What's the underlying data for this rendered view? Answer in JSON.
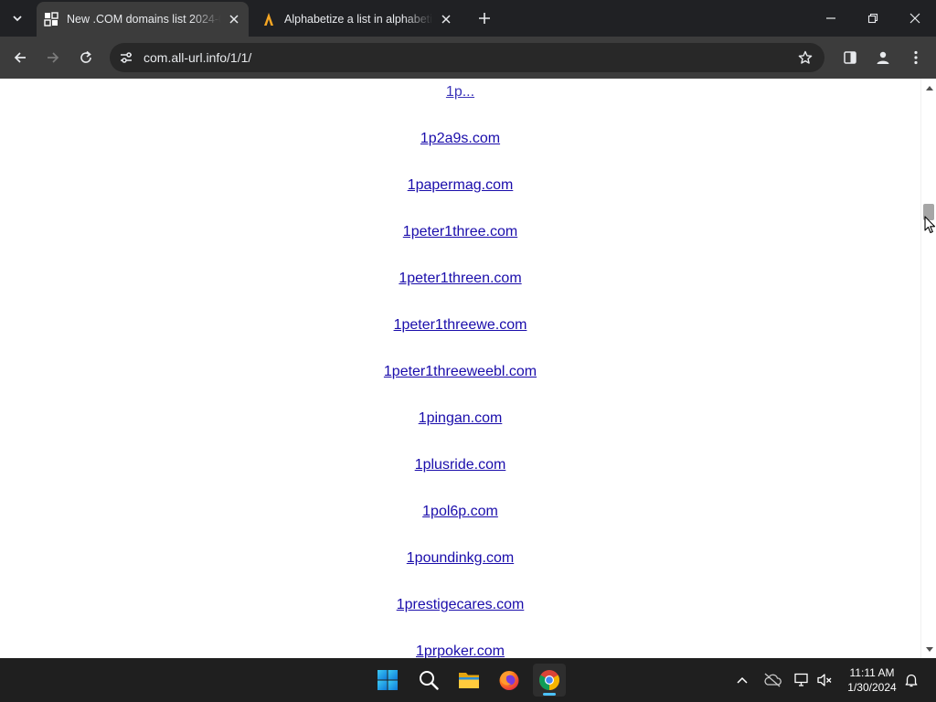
{
  "browser": {
    "tabs": [
      {
        "title": "New .COM domains list 2024-0",
        "active": true,
        "favicon": "grid-favicon-icon"
      },
      {
        "title": "Alphabetize a list in alphabetica",
        "active": false,
        "favicon": "orange-a-favicon-icon"
      }
    ],
    "url": "com.all-url.info/1/1/"
  },
  "page": {
    "partial_top_link": "1p...",
    "domains": [
      "1p2a9s.com",
      "1papermag.com",
      "1peter1three.com",
      "1peter1threen.com",
      "1peter1threewe.com",
      "1peter1threeweebl.com",
      "1pingan.com",
      "1plusride.com",
      "1pol6p.com",
      "1poundinkg.com",
      "1prestigecares.com",
      "1prpoker.com"
    ]
  },
  "taskbar": {
    "apps": [
      "windows-start-icon",
      "search-icon",
      "file-explorer-icon",
      "firefox-icon",
      "chrome-icon"
    ],
    "time": "11:11 AM",
    "date": "1/30/2024"
  },
  "colors": {
    "link": "#1a0dab",
    "tab_strip": "#202124",
    "toolbar": "#3c3c3c",
    "taskbar": "#1f1f1f"
  }
}
